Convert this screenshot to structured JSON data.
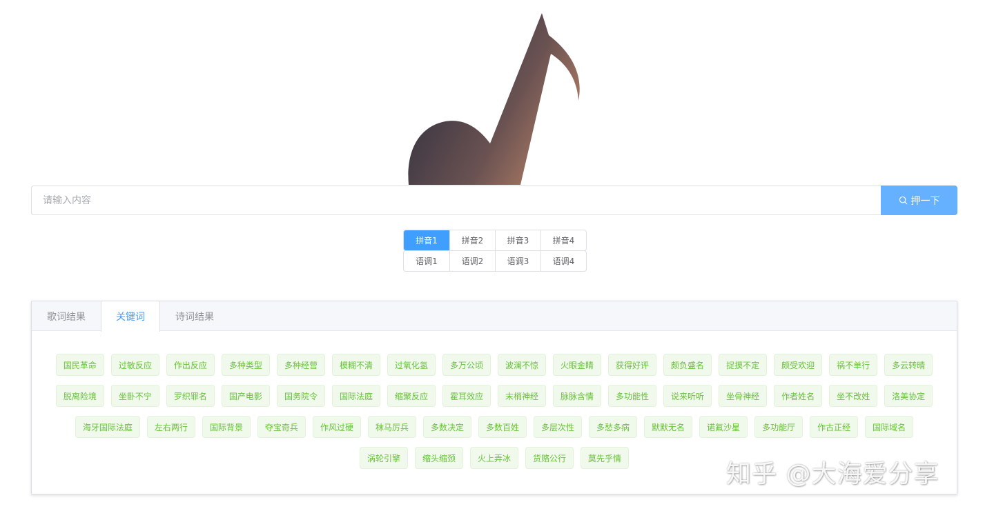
{
  "logo": {
    "icon": "music-note-icon",
    "gradient_dark": "#33313f",
    "gradient_light": "#b88165"
  },
  "search": {
    "placeholder": "请输入内容",
    "value": "",
    "button_label": "押一下",
    "button_icon": "search-icon",
    "button_color": "#66b1ff"
  },
  "pinyin_options": [
    "拼音1",
    "拼音2",
    "拼音3",
    "拼音4"
  ],
  "pinyin_selected": "拼音1",
  "tone_options": [
    "语调1",
    "语调2",
    "语调3",
    "语调4"
  ],
  "accent_color": "#409eff",
  "tabs": [
    {
      "label": "歌词结果",
      "active": false
    },
    {
      "label": "关键词",
      "active": true
    },
    {
      "label": "诗词结果",
      "active": false
    }
  ],
  "keywords": [
    "国民革命",
    "过敏反应",
    "作出反应",
    "多种类型",
    "多种经营",
    "模糊不清",
    "过氧化氢",
    "多万公顷",
    "波澜不惊",
    "火眼金睛",
    "获得好评",
    "颇负盛名",
    "捉摸不定",
    "颇受欢迎",
    "祸不单行",
    "多云转晴",
    "脱离险境",
    "坐卧不宁",
    "罗织罪名",
    "国产电影",
    "国务院令",
    "国际法庭",
    "缩聚反应",
    "霍耳效应",
    "末梢神经",
    "脉脉含情",
    "多功能性",
    "说来听听",
    "坐骨神经",
    "作者姓名",
    "坐不改姓",
    "洛美协定",
    "海牙国际法庭",
    "左右两行",
    "国际背景",
    "夺宝奇兵",
    "作风过硬",
    "秣马厉兵",
    "多数决定",
    "多数百姓",
    "多层次性",
    "多愁多病",
    "默默无名",
    "诺氟沙星",
    "多功能厅",
    "作古正经",
    "国际域名",
    "涡轮引擎",
    "缩头缩颈",
    "火上弄冰",
    "货赂公行",
    "莫先乎情"
  ],
  "tag_color": "#67c23a",
  "watermark": "知乎 @大海爱分享"
}
